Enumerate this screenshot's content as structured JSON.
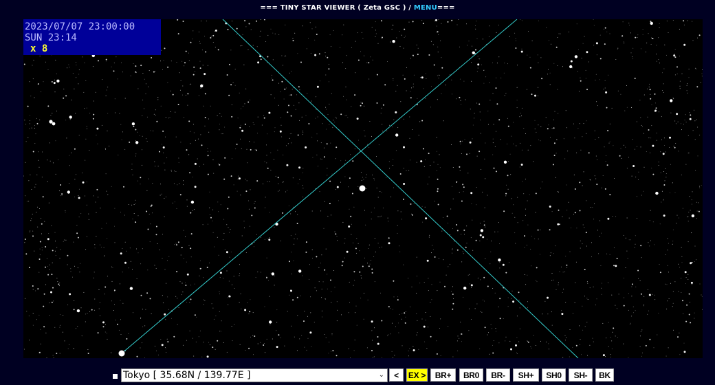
{
  "title": {
    "prefix": "=== TINY STAR VIEWER ( Zeta GSC ) / ",
    "menu_label": "MENU",
    "suffix": "==="
  },
  "info": {
    "datetime": "2023/07/07 23:00:00",
    "local_time": "SUN 23:14",
    "zoom": "x 8"
  },
  "location_select": {
    "selected": "Tokyo [ 35.68N / 139.77E ]"
  },
  "buttons": [
    {
      "label": "<",
      "name": "prev-button",
      "active": false
    },
    {
      "label": "EX >",
      "name": "ex-next-button",
      "active": true
    },
    {
      "label": "BR+",
      "name": "brightness-up-button",
      "active": false
    },
    {
      "label": "BR0",
      "name": "brightness-reset-button",
      "active": false
    },
    {
      "label": "BR-",
      "name": "brightness-down-button",
      "active": false
    },
    {
      "label": "SH+",
      "name": "sharpness-up-button",
      "active": false
    },
    {
      "label": "SH0",
      "name": "sharpness-reset-button",
      "active": false
    },
    {
      "label": "SH-",
      "name": "sharpness-down-button",
      "active": false
    },
    {
      "label": "BK",
      "name": "back-button",
      "active": false
    }
  ],
  "colors": {
    "sky": "#000000",
    "page": "#000022",
    "guide_line": "#33cccc",
    "info_box": "#000099",
    "active_button": "#ffff00"
  }
}
